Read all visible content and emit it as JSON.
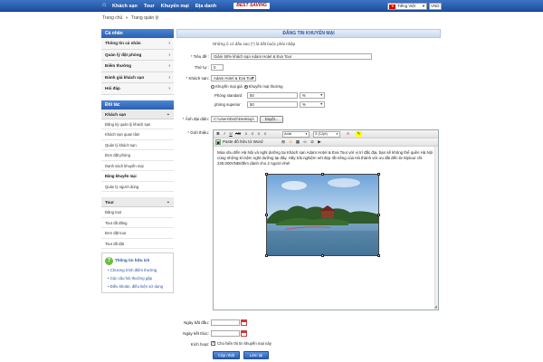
{
  "topnav": {
    "items": [
      "Khách sạn",
      "Tour",
      "Khuyến mại",
      "Địa danh"
    ],
    "hotline": "BEST SAVING",
    "language": "Tiếng Việt",
    "currency": "VND"
  },
  "breadcrumb": {
    "home": "Trang chủ",
    "sep": "»",
    "current": "Trang quản lý"
  },
  "sidebar": {
    "personal_header": "Cá nhân",
    "personal_items": [
      "Thông tin cá nhân",
      "Quản lý đặt phòng",
      "Điểm thưởng",
      "Đánh giá khách sạn",
      "Hỏi đáp"
    ],
    "partner_header": "Đối tác",
    "hotel_group": "Khách sạn",
    "hotel_items": [
      "Đăng ký quản lý khách sạn",
      "Khách sạn quan tâm",
      "Quản lý khách sạn",
      "Đơn đặt phòng",
      "Danh sách khuyến mại",
      "Đăng khuyến mại",
      "Quản lý người dùng"
    ],
    "tour_group": "Tour",
    "tour_items": [
      "Đăng tour",
      "Tour đã đăng",
      "Đơn đặt tour",
      "Tour đã đặt"
    ],
    "help_title": "Thông tin hữu ích",
    "help_links": [
      "Chương trình điểm thưởng",
      "Các câu hỏi thường gặp",
      "Điều khoản, điều kiện sử dụng"
    ]
  },
  "form": {
    "header": "ĐĂNG TIN KHUYẾN MẠI",
    "note": "Những ô có dấu sao (*) là bắt buộc phải nhập",
    "title_label": "Tiêu đề :",
    "title_value": "Giảm 50% khách sạn Adam Hotel & Eva Tour",
    "order_label": "Thứ tự :",
    "order_value": "0",
    "hotel_label": "Khách sạn:",
    "hotel_value": "Adam Hotel & Eva Tour",
    "radio_options": [
      "Khuyến mại giá",
      "Khuyến mại thường"
    ],
    "room_standard_label": "Phòng standard",
    "room_standard_value": "50",
    "room_superior_label": "phòng superior",
    "room_superior_value": "50",
    "unit": "%",
    "image_label": "Ảnh đại diện:",
    "image_value": "C:\\Users\\DoD\\Desktop\\",
    "browse_label": "Duyệt...",
    "intro_label": "Giới thiệu:",
    "editor": {
      "font": "Arial",
      "size": "3 (12pt)",
      "paste_word": "Paste đồ hữu từ Word",
      "body": "Mùa xhu đến Hà Nội và nghỉ dưỡng tại Khách sạn Adam Hotel & Eva Tour với vị trí đắc địa, bạn sẽ không thể quên Hà Nội cùng những kỉ niệm nghỉ dưỡng tại đây. Hãy trải nghiệm nét đẹp rất riêng của Hà thành với ưu đãi đến từ Mytour chỉ 225.000VNĐ/đêm dành cho 2 người nhé!"
    },
    "start_label": "Ngày bắt đầu:",
    "end_label": "Ngày kết thúc:",
    "active_label": "Kích hoạt:",
    "active_text": "Cho hiển thị tin khuyến mại này",
    "submit_label": "Cập nhật",
    "reset_label": "Làm lại"
  },
  "colors": {
    "nav": "#2a5fb0",
    "accent": "#2a55a0",
    "required": "#d00000"
  }
}
